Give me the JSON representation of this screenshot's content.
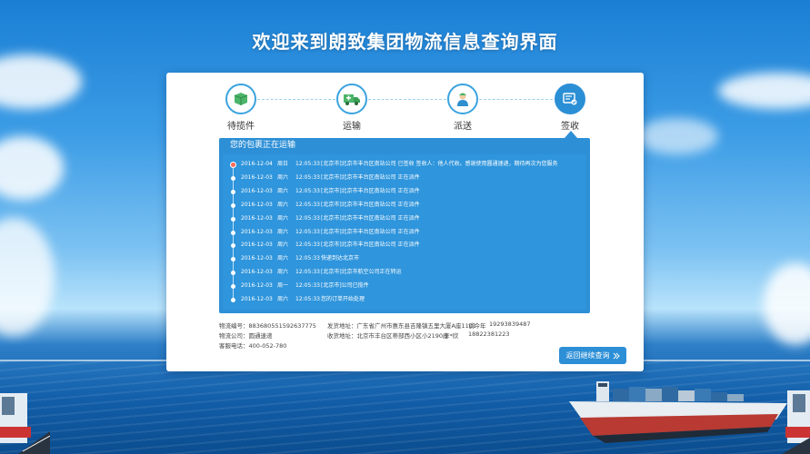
{
  "page_title": "欢迎来到朗致集团物流信息查询界面",
  "steps": [
    {
      "label": "待揽件",
      "icon": "package-icon"
    },
    {
      "label": "运输",
      "icon": "truck-icon"
    },
    {
      "label": "派送",
      "icon": "courier-icon"
    },
    {
      "label": "签收",
      "icon": "sign-receipt-icon"
    }
  ],
  "tracking": {
    "header": "您的包裹正在运输",
    "rows": [
      {
        "date": "2016-12-04",
        "day": "周日",
        "time": "12:05:33",
        "desc": "[北京市]北京市丰台区南站公司 已签收 签收人：他人代收。感谢使用圆通速递，期待再次为您服务"
      },
      {
        "date": "2016-12-03",
        "day": "周六",
        "time": "12:05:33",
        "desc": "[北京市]北京市丰台区南站公司 正在派件"
      },
      {
        "date": "2016-12-03",
        "day": "周六",
        "time": "12:05:33",
        "desc": "[北京市]北京市丰台区南站公司 正在派件"
      },
      {
        "date": "2016-12-03",
        "day": "周六",
        "time": "12:05:33",
        "desc": "[北京市]北京市丰台区南站公司 正在派件"
      },
      {
        "date": "2016-12-03",
        "day": "周六",
        "time": "12:05:33",
        "desc": "[北京市]北京市丰台区南站公司 正在派件"
      },
      {
        "date": "2016-12-03",
        "day": "周六",
        "time": "12:05:33",
        "desc": "[北京市]北京市丰台区南站公司 正在派件"
      },
      {
        "date": "2016-12-03",
        "day": "周六",
        "time": "12:05:33",
        "desc": "[北京市]北京市丰台区南站公司 正在派件"
      },
      {
        "date": "2016-12-03",
        "day": "周六",
        "time": "12:05:33",
        "desc": "快递到达北京市"
      },
      {
        "date": "2016-12-03",
        "day": "周六",
        "time": "12:05:33",
        "desc": "[北京市]北京市航空公司正在转运"
      },
      {
        "date": "2016-12-03",
        "day": "周一",
        "time": "12:05:33",
        "desc": "[北京市]公司已揽件"
      },
      {
        "date": "2016-12-03",
        "day": "周六",
        "time": "12:05:33",
        "desc": "您的订单开始处理"
      }
    ]
  },
  "info": {
    "tracking_number": "物流编号：883680551592637775",
    "carrier": "物流公司：圆通速递",
    "service_phone": "客服电话：400-052-780",
    "sender_address": "发货地址：广东省广州市惠东县吉隆镇五里大厦A座1101",
    "sender_name": "谈今年",
    "sender_phone": "19293839487",
    "receiver_address": "收货地址：北京市丰台区蒂部西小区小2190座",
    "receiver_name": "李*欣",
    "receiver_phone": "18822381223"
  },
  "back_button": {
    "label": "返回继续查询",
    "icon": "double-chevron-right-icon"
  },
  "colors": {
    "accent": "#2d8fd6",
    "current_point": "#ff6a5a"
  }
}
